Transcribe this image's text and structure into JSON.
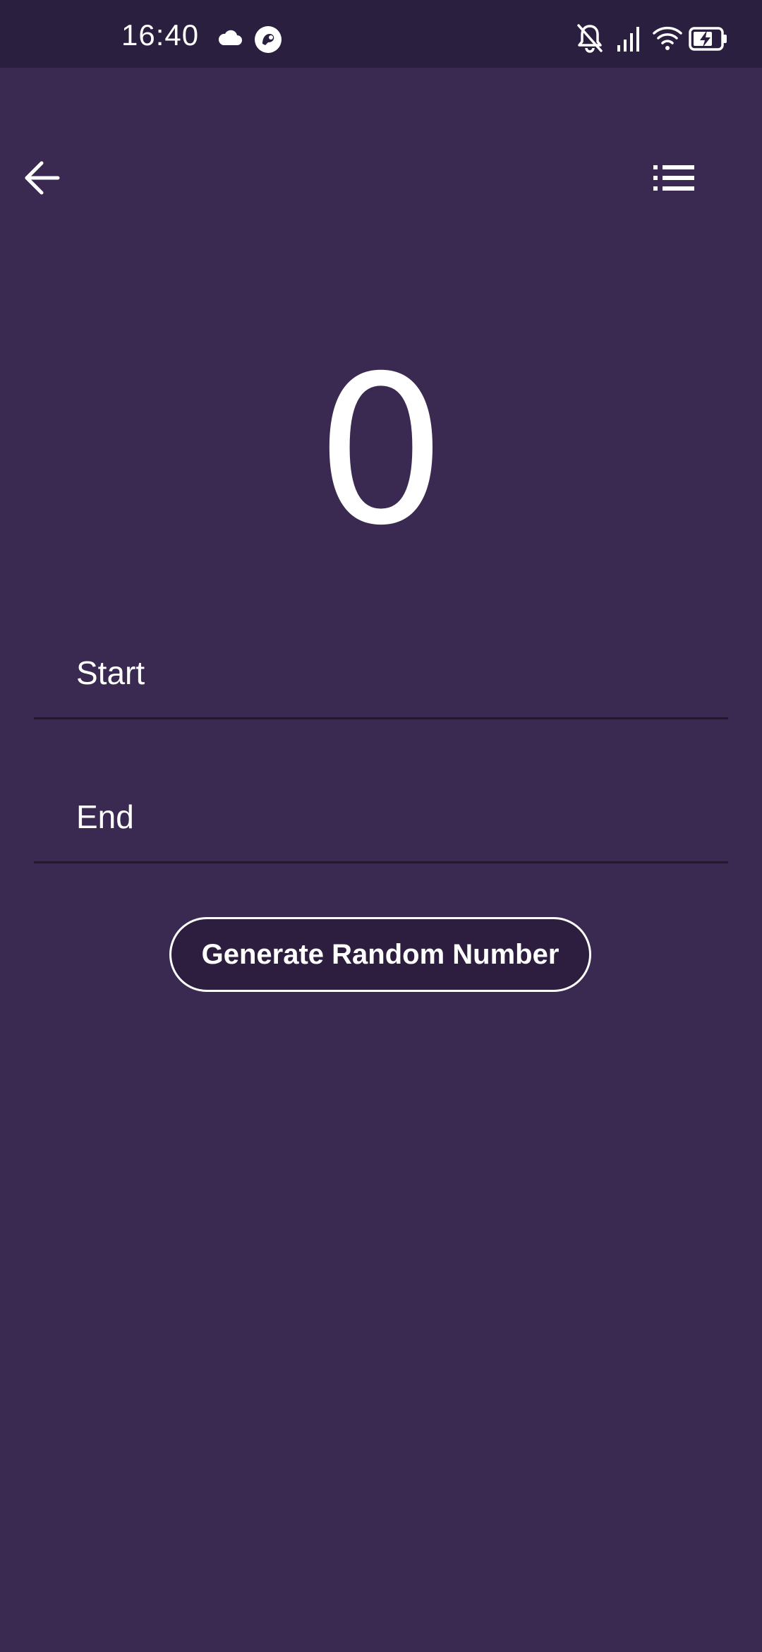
{
  "status_bar": {
    "time": "16:40",
    "icons": [
      "cloud-icon",
      "notification-app-icon",
      "bell-off-icon",
      "signal-icon",
      "wifi-icon",
      "battery-charging-icon"
    ]
  },
  "app_bar": {
    "back_icon": "arrow-left-icon",
    "menu_icon": "list-icon"
  },
  "main": {
    "result": "0",
    "start_label": "Start",
    "end_label": "End",
    "generate_label": "Generate Random Number"
  },
  "colors": {
    "background": "#3a2950",
    "status_bar": "#2b1f3f",
    "button_fill": "#2d1e3f",
    "divider": "#221832",
    "text": "#ffffff"
  }
}
